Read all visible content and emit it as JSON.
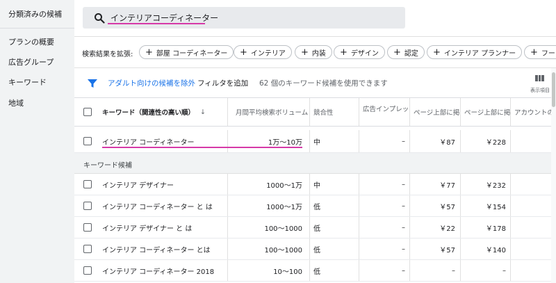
{
  "sidebar": {
    "items": [
      {
        "label": "分類済みの候補"
      },
      {
        "label": "プランの概要"
      },
      {
        "label": "広告グループ"
      },
      {
        "label": "キーワード"
      },
      {
        "label": "地域"
      }
    ]
  },
  "search": {
    "query": "インテリアコーディネーター",
    "icon": "search-icon"
  },
  "refine": {
    "label": "検索結果を拡張:",
    "chips": [
      "部屋 コーディネーター",
      "インテリア",
      "内装",
      "デザイン",
      "認定",
      "インテリア プランナー",
      "フート"
    ]
  },
  "filter": {
    "adult_exclude": "アダルト向けの候補を除外",
    "add_filter": "フィルタを追加",
    "count_text": "62 個のキーワード候補を使用できます",
    "columns_label": "表示項目"
  },
  "table": {
    "headers": {
      "keyword": "キーワード（関連性の高い順）",
      "volume": "月間平均検索ボリューム",
      "competition": "競合性",
      "impression": "広告インプレッ",
      "top_low": "ページ上部に掲",
      "top_high": "ページ上部に掲",
      "account": "アカウントの"
    },
    "query_row": {
      "keyword": "インテリア コーディネーター",
      "volume": "1万～10万",
      "competition": "中",
      "impression": "–",
      "top_low": "￥87",
      "top_high": "￥228"
    },
    "section_label": "キーワード候補",
    "rows": [
      {
        "keyword": "インテリア デザイナー",
        "volume": "1000～1万",
        "competition": "中",
        "impression": "–",
        "top_low": "￥77",
        "top_high": "￥232"
      },
      {
        "keyword": "インテリア コーディネーター と は",
        "volume": "1000～1万",
        "competition": "低",
        "impression": "–",
        "top_low": "￥57",
        "top_high": "￥154"
      },
      {
        "keyword": "インテリア デザイナー と は",
        "volume": "100～1000",
        "competition": "低",
        "impression": "–",
        "top_low": "￥22",
        "top_high": "￥178"
      },
      {
        "keyword": "インテリア コーディネーター とは",
        "volume": "100～1000",
        "competition": "低",
        "impression": "–",
        "top_low": "￥57",
        "top_high": "￥140"
      },
      {
        "keyword": "インテリア コーディネーター 2018",
        "volume": "10～100",
        "competition": "低",
        "impression": "–",
        "top_low": "–",
        "top_high": "–"
      }
    ]
  },
  "colors": {
    "accent": "#1a73e8",
    "highlight": "#d63aa8"
  }
}
